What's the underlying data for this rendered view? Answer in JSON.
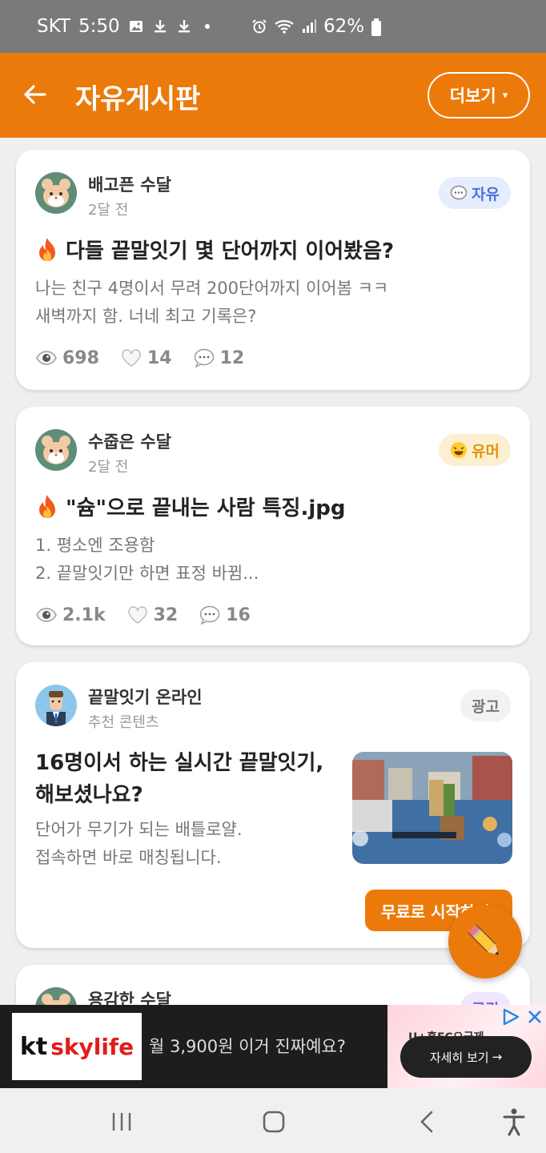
{
  "status_bar": {
    "carrier": "SKT",
    "time": "5:50",
    "battery": "62%",
    "icons": [
      "image-icon",
      "download-icon",
      "download-icon",
      "dot-icon",
      "alarm-icon",
      "wifi-icon",
      "signal-icon",
      "battery-icon"
    ]
  },
  "app_bar": {
    "title": "자유게시판",
    "more_label": "더보기",
    "more_caret": "▾",
    "back_icon": "arrow-left-icon",
    "bg_color": "#ec7a0b"
  },
  "posts": [
    {
      "author": "배고픈 수달",
      "time": "2달 전",
      "tag": "자유",
      "tag_icon": "chat-bubble-icon",
      "title": "다들 끝말잇기 몇 단어까지 이어봤음?",
      "body_lines": [
        "나는 친구 4명이서 무려 200단어까지 이어봄 ㅋㅋ",
        "새벽까지 함. 너네 최고 기록은?"
      ],
      "views": "698",
      "likes": "14",
      "comments": "12"
    },
    {
      "author": "수줍은 수달",
      "time": "2달 전",
      "tag": "유머",
      "tag_icon": "laughing-face-icon",
      "title": "\"슘\"으로 끝내는 사람 특징.jpg",
      "body_lines": [
        "1. 평소엔 조용함",
        "2. 끝말잇기만 하면 표정 바뀜..."
      ],
      "views": "2.1k",
      "likes": "32",
      "comments": "16"
    }
  ],
  "ad_card": {
    "author": "끝말잇기 온라인",
    "subtitle": "추천 콘텐츠",
    "tag": "광고",
    "title_lines": [
      "16명이서 하는 실시간 끝말잇기,",
      "해보셨나요?"
    ],
    "body_lines": [
      "단어가 무기가 되는 배틀로얄.",
      "접속하면 바로 매칭됩니다."
    ],
    "cta": "무료로 시작하기"
  },
  "partial_post": {
    "author": "용감한 수달",
    "tag": "공감"
  },
  "fab": {
    "icon": "pencil-icon"
  },
  "banner": {
    "brand_kt": "kt",
    "brand_sky": "skylife",
    "text": "월 3,900원 이거 진짜예요?",
    "button": "자세히 보기",
    "button_arrow": "→",
    "right_text": "U+홈FC요금제"
  },
  "nav_bar": {
    "icons": [
      "recent-apps-icon",
      "home-icon",
      "back-icon",
      "accessibility-icon"
    ]
  }
}
